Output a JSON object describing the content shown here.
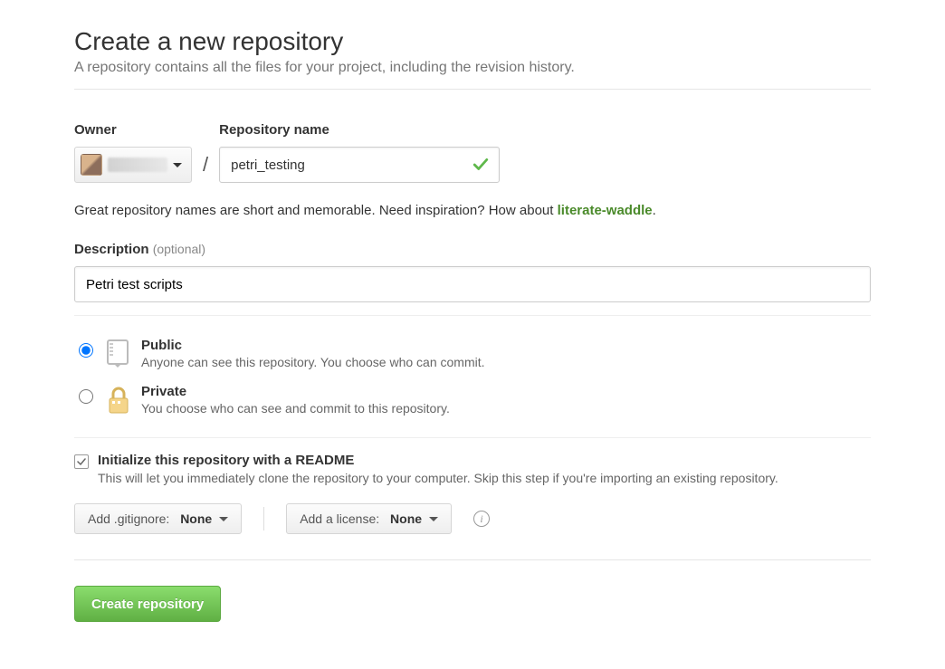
{
  "header": {
    "title": "Create a new repository",
    "subtitle": "A repository contains all the files for your project, including the revision history."
  },
  "owner": {
    "label": "Owner"
  },
  "repo": {
    "label": "Repository name",
    "value": "petri_testing",
    "name_valid": true
  },
  "name_hint": {
    "prefix": "Great repository names are short and memorable. Need inspiration? How about ",
    "suggestion": "literate-waddle",
    "suffix": "."
  },
  "description": {
    "label": "Description",
    "optional": "(optional)",
    "value": "Petri test scripts"
  },
  "visibility": {
    "selected": "public",
    "public": {
      "title": "Public",
      "sub": "Anyone can see this repository. You choose who can commit."
    },
    "private": {
      "title": "Private",
      "sub": "You choose who can see and commit to this repository."
    }
  },
  "initialize": {
    "checked": true,
    "title": "Initialize this repository with a README",
    "sub": "This will let you immediately clone the repository to your computer. Skip this step if you're importing an existing repository."
  },
  "gitignore": {
    "label": "Add .gitignore:",
    "value": "None"
  },
  "license": {
    "label": "Add a license:",
    "value": "None"
  },
  "submit": {
    "label": "Create repository"
  }
}
